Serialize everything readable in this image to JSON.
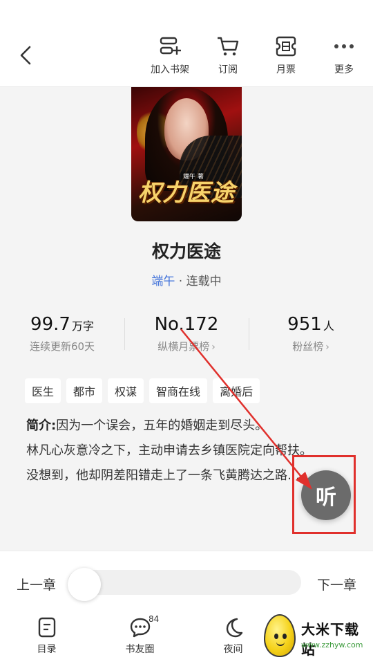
{
  "header": {
    "actions": [
      {
        "label": "加入书架",
        "icon": "add-to-shelf-icon"
      },
      {
        "label": "订阅",
        "icon": "cart-icon"
      },
      {
        "label": "月票",
        "icon": "monthly-ticket-icon"
      },
      {
        "label": "更多",
        "icon": "more-icon"
      }
    ]
  },
  "book": {
    "cover_title": "权力医途",
    "cover_author": "端午 著",
    "title": "权力医途",
    "author": "端午",
    "separator": " · ",
    "status": "连载中"
  },
  "stats": [
    {
      "value": "99.7",
      "unit": "万字",
      "label": "连续更新60天",
      "arrow": ""
    },
    {
      "value": "No.172",
      "unit": "",
      "label": "纵横月票榜",
      "arrow": "›"
    },
    {
      "value": "951",
      "unit": "人",
      "label": "粉丝榜",
      "arrow": "›"
    }
  ],
  "tags": [
    "医生",
    "都市",
    "权谋",
    "智商在线",
    "离婚后"
  ],
  "intro": {
    "label": "简介:",
    "line1": "因为一个误会，五年的婚姻走到尽头。",
    "line2": "林凡心灰意冷之下，主动申请去乡镇医院定向帮扶。",
    "line3": "没想到，他却阴差阳错走上了一条飞黄腾达之路……"
  },
  "listen_button": {
    "label": "听"
  },
  "chapter_nav": {
    "prev": "上一章",
    "next": "下一章",
    "progress": 0.0
  },
  "bottom_nav": [
    {
      "label": "目录",
      "icon": "catalog-icon"
    },
    {
      "label": "书友圈",
      "icon": "comment-icon",
      "badge": "84"
    },
    {
      "label": "夜间",
      "icon": "moon-icon"
    },
    {
      "label": "",
      "icon": "chevron-up-icon"
    }
  ],
  "watermark": {
    "name": "大米下载站",
    "url": "www.zzhyw.com"
  },
  "colors": {
    "accent_blue": "#3d6fd9",
    "annotation_red": "#e0302c",
    "listen_gray": "#6b6b6b"
  }
}
